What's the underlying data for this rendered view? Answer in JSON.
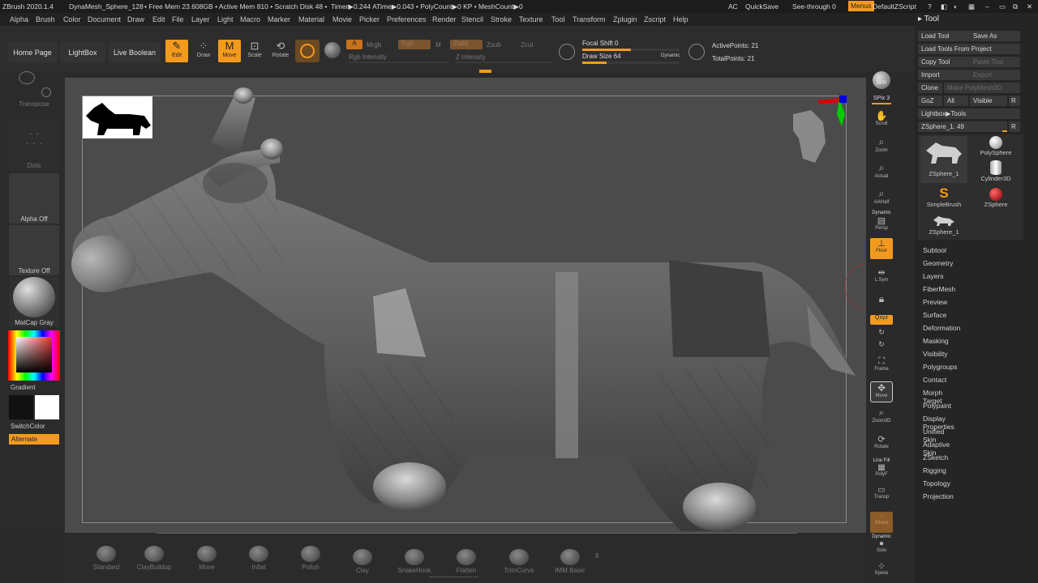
{
  "title_bar": {
    "app": "ZBrush 2020.1.4",
    "document": "DynaMesh_Sphere_128",
    "free_mem": "• Free Mem 23.608GB • Active Mem 810 • Scratch Disk 48 •",
    "timer": "Timer▶0.244 ATime▶0.043 • PolyCount▶0 KP • MeshCount▶0",
    "ac": "AC",
    "quicksave": "QuickSave",
    "see_through": "See-through 0",
    "menus": "Menus",
    "default_script": "DefaultZScript"
  },
  "menu": [
    "Alpha",
    "Brush",
    "Color",
    "Document",
    "Draw",
    "Edit",
    "File",
    "Layer",
    "Light",
    "Macro",
    "Marker",
    "Material",
    "Movie",
    "Picker",
    "Preferences",
    "Render",
    "Stencil",
    "Stroke",
    "Texture",
    "Tool",
    "Transform",
    "Zplugin",
    "Zscript",
    "Help"
  ],
  "top_shelf": {
    "home_page": "Home Page",
    "lightbox": "LightBox",
    "live_boolean": "Live Boolean",
    "edit": "Edit",
    "draw": "Draw",
    "move": "Move",
    "scale": "Scale",
    "rotate": "Rotate",
    "a": "A",
    "mrgb": "Mrgb",
    "rgb": "Rgb",
    "m": "M",
    "zadd": "Zadd",
    "zsub": "Zsub",
    "zcut": "Zcut",
    "rgb_intensity": "Rgb Intensity",
    "z_intensity": "Z Intensity",
    "focal_shift": "Focal Shift 0",
    "draw_size": "Draw Size 64",
    "dynamic": "Dynamic",
    "active_points": "ActivePoints: 21",
    "total_points": "TotalPoints: 21",
    "focal_shift_level": 0.5,
    "draw_size_level": 0.25
  },
  "left_shelf": {
    "transpose": "Transpose",
    "dots": "Dots",
    "alpha_off": "Alpha Off",
    "texture_off": "Texture Off",
    "matcap": "MatCap Gray",
    "gradient": "Gradient",
    "switch_color": "SwitchColor",
    "alternate": "Alternate"
  },
  "right_shelf": {
    "bpr": "BPR",
    "spix": "SPix 3",
    "scroll": "Scroll",
    "zoom": "Zoom",
    "actual": "Actual",
    "aahalf": "AAHalf",
    "dynamic": "Dynamic",
    "persp": "Persp",
    "floor": "Floor",
    "lsym": "L.Sym",
    "xyz": "Qxyz",
    "frame": "Frame",
    "move": "Move",
    "zoom3d": "Zoom3D",
    "rotate": "Rotate",
    "line_fill": "Line Fill",
    "polyf": "PolyF",
    "transp": "Transp",
    "ghost": "Ghost",
    "solo": "Solo",
    "xpose": "Xpose"
  },
  "tool_panel": {
    "title": "Tool",
    "load_tool": "Load Tool",
    "save_as": "Save As",
    "load_from_project": "Load Tools From Project",
    "copy_tool": "Copy Tool",
    "paste_tool": "Paste Tool",
    "import": "Import",
    "export": "Export",
    "clone": "Clone",
    "make_polymesh": "Make PolyMesh3D",
    "goz": "GoZ",
    "all": "All",
    "visible": "Visible",
    "r": "R",
    "lightbox_tools": "Lightbox▶Tools",
    "current_tool": "ZSphere_1. 49",
    "tools": [
      "ZSphere_1",
      "PolySphere",
      "Cylinder3D",
      "SimpleBrush",
      "ZSphere",
      "ZSphere_1"
    ],
    "subpalettes": [
      "Subtool",
      "Geometry",
      "Layers",
      "FiberMesh",
      "Preview",
      "Surface",
      "Deformation",
      "Masking",
      "Visibility",
      "Polygroups",
      "Contact",
      "Morph Target",
      "Polypaint",
      "Display Properties",
      "Unified Skin",
      "Adaptive Skin",
      "ZSketch",
      "Rigging",
      "Topology",
      "Projection"
    ]
  },
  "brushes": [
    "Standard",
    "ClayBuildup",
    "Move",
    "Inflat",
    "Polish",
    "Clay",
    "SnakeHook",
    "Flatten",
    "TrimCurve",
    "IMM Basic"
  ],
  "brush_count": "8",
  "colors": {
    "accent": "#f39a1e",
    "primary_color": "#111111",
    "secondary_color": "#ffffff"
  }
}
